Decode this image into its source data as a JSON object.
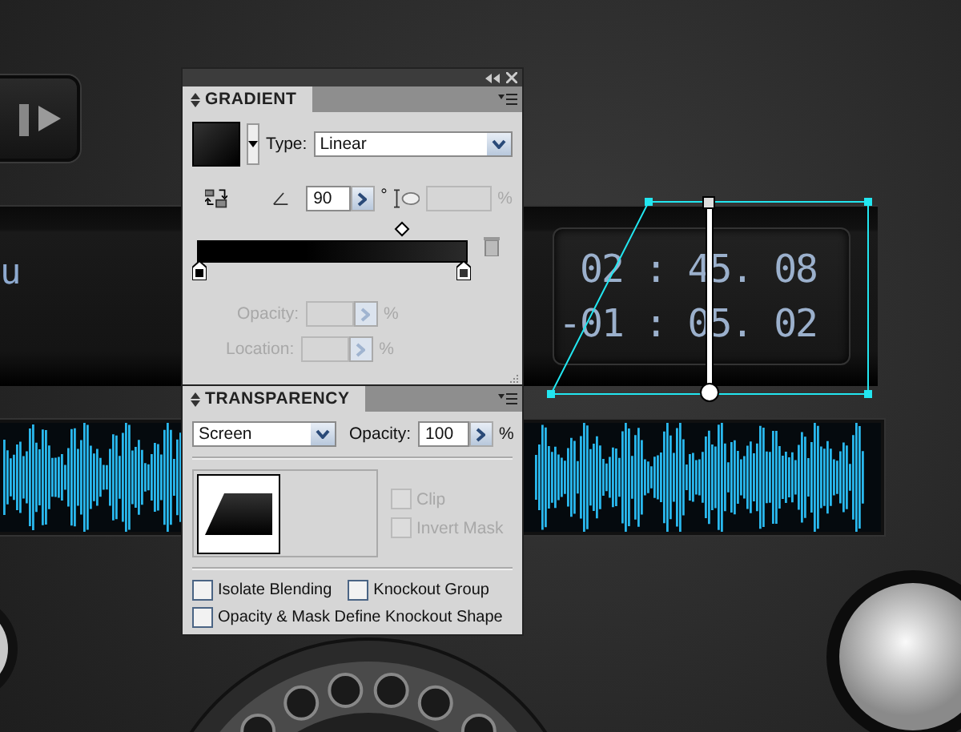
{
  "canvas": {
    "track_text": "u",
    "elapsed": "02 : 45. 08",
    "remaining": "-01 : 05. 02"
  },
  "gradient_panel": {
    "title": "GRADIENT",
    "type_label": "Type:",
    "type_value": "Linear",
    "angle": "90",
    "degree_symbol": "°",
    "aspect": {
      "unit": "%",
      "disabled": true
    },
    "opacity": {
      "label": "Opacity:",
      "unit": "%",
      "disabled": true
    },
    "location": {
      "label": "Location:",
      "unit": "%",
      "disabled": true
    }
  },
  "transparency_panel": {
    "title": "TRANSPARENCY",
    "blend_mode": "Screen",
    "opacity_label": "Opacity:",
    "opacity": "100",
    "opacity_unit": "%",
    "mask_options": [
      {
        "label": "Clip",
        "checked": false,
        "disabled": true
      },
      {
        "label": "Invert Mask",
        "checked": false,
        "disabled": true
      }
    ],
    "options": [
      {
        "label": "Isolate Blending",
        "checked": false
      },
      {
        "label": "Knockout Group",
        "checked": false
      },
      {
        "label": "Opacity & Mask Define Knockout Shape",
        "checked": false
      }
    ]
  }
}
